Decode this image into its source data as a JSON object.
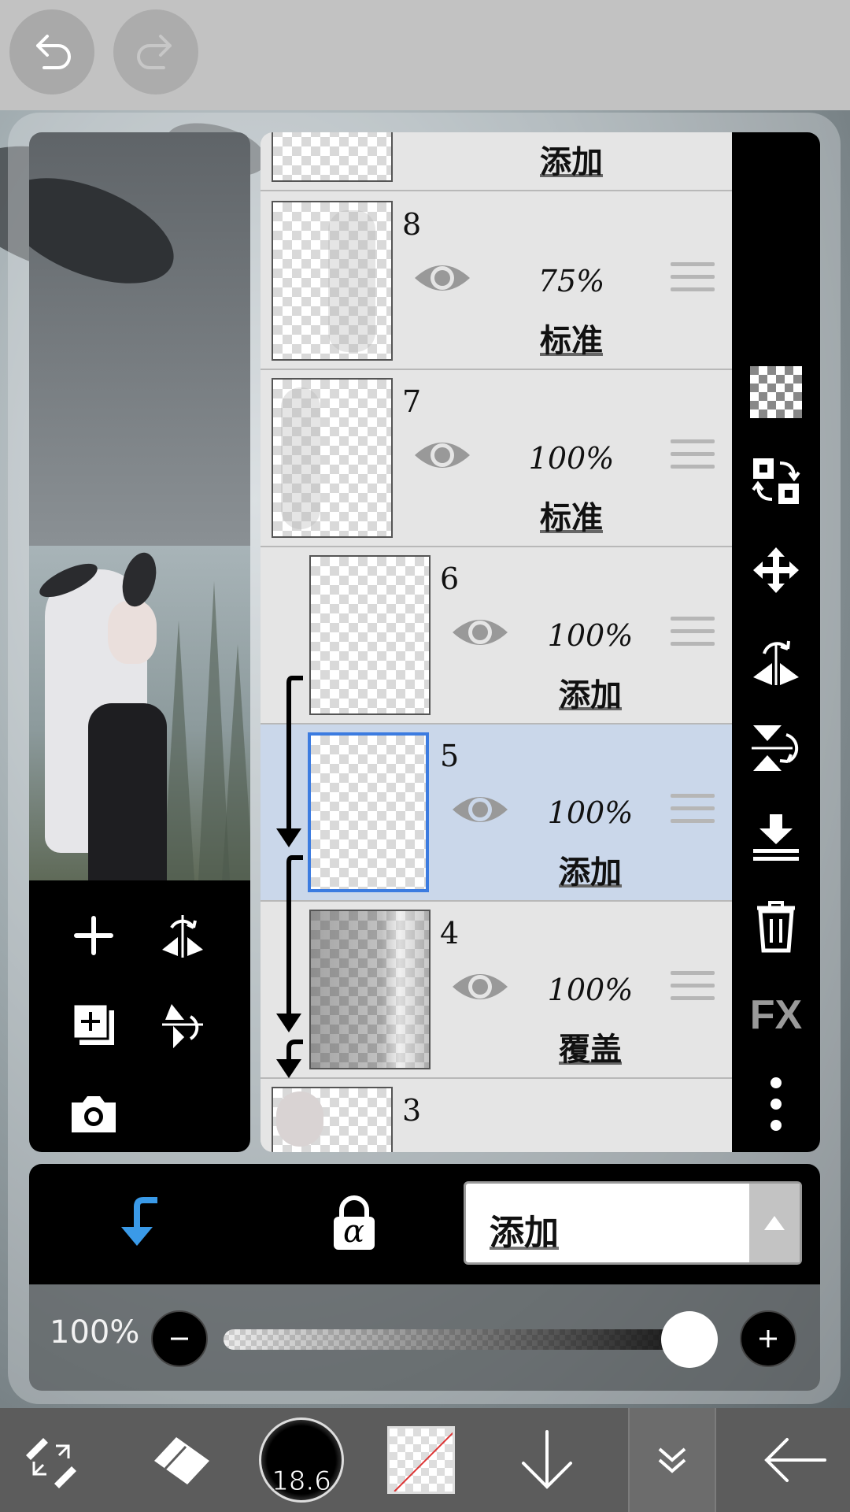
{
  "toolbar": {
    "undo_icon": "undo-icon",
    "redo_icon": "redo-icon"
  },
  "layers": {
    "selected_index": 5,
    "rows": [
      {
        "number": "",
        "opacity": "",
        "blend": "添加",
        "visible": true,
        "clipped": false
      },
      {
        "number": "8",
        "opacity": "75%",
        "blend": "标准",
        "visible": true,
        "clipped": false
      },
      {
        "number": "7",
        "opacity": "100%",
        "blend": "标准",
        "visible": true,
        "clipped": false
      },
      {
        "number": "6",
        "opacity": "100%",
        "blend": "添加",
        "visible": true,
        "clipped": true
      },
      {
        "number": "5",
        "opacity": "100%",
        "blend": "添加",
        "visible": true,
        "clipped": true
      },
      {
        "number": "4",
        "opacity": "100%",
        "blend": "覆盖",
        "visible": true,
        "clipped": true
      },
      {
        "number": "3",
        "opacity": "",
        "blend": "",
        "visible": true,
        "clipped": false
      }
    ]
  },
  "right_tools": [
    "transparency-icon",
    "swap-layer-icon",
    "move-icon",
    "flip-horizontal-icon",
    "flip-vertical-icon",
    "merge-down-icon",
    "trash-icon",
    "fx",
    "more-icon"
  ],
  "right_tools_fx_label": "FX",
  "preview_tools": [
    "add-layer-icon",
    "flip-horizontal-icon",
    "add-copy-layer-icon",
    "flip-vertical-icon",
    "camera-icon"
  ],
  "blend_bar": {
    "clip_icon": "clipping-icon",
    "alpha_lock_icon": "alpha-lock-icon",
    "alpha_symbol": "α",
    "blend_mode": "添加"
  },
  "opacity_slider": {
    "label": "100%",
    "value": 1.0
  },
  "bottom_bar": {
    "tools": [
      "transform-tool-icon",
      "eraser-icon",
      "brush-size",
      "color-swatch",
      "arrow-down-icon",
      "chevron-double-down-icon",
      "back-arrow-icon"
    ],
    "brush_size": "18.6"
  },
  "colors": {
    "selected_row": "#cad7ea",
    "selected_border": "#3b7be0",
    "clip_arrow": "#3a9ae8"
  }
}
